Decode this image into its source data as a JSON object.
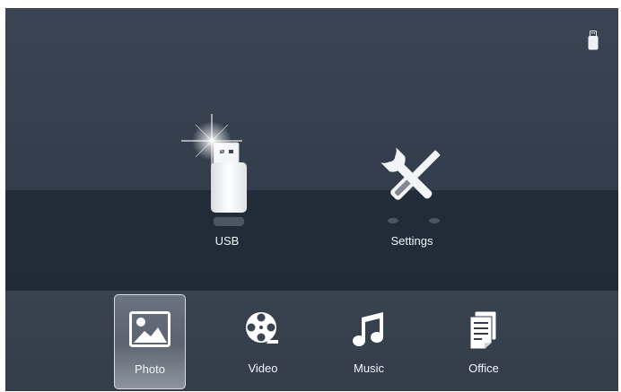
{
  "main": {
    "items": [
      {
        "label": "USB",
        "icon": "usb-drive-icon"
      },
      {
        "label": "Settings",
        "icon": "tools-icon"
      }
    ]
  },
  "dock": {
    "items": [
      {
        "label": "Photo",
        "icon": "photo-icon",
        "selected": true
      },
      {
        "label": "Video",
        "icon": "film-reel-icon",
        "selected": false
      },
      {
        "label": "Music",
        "icon": "music-note-icon",
        "selected": false
      },
      {
        "label": "Office",
        "icon": "document-icon",
        "selected": false
      }
    ]
  },
  "status": {
    "icon": "usb-status-icon"
  },
  "colors": {
    "background": "#343d4b",
    "band": "#222c38",
    "text": "#f2f4f7"
  }
}
